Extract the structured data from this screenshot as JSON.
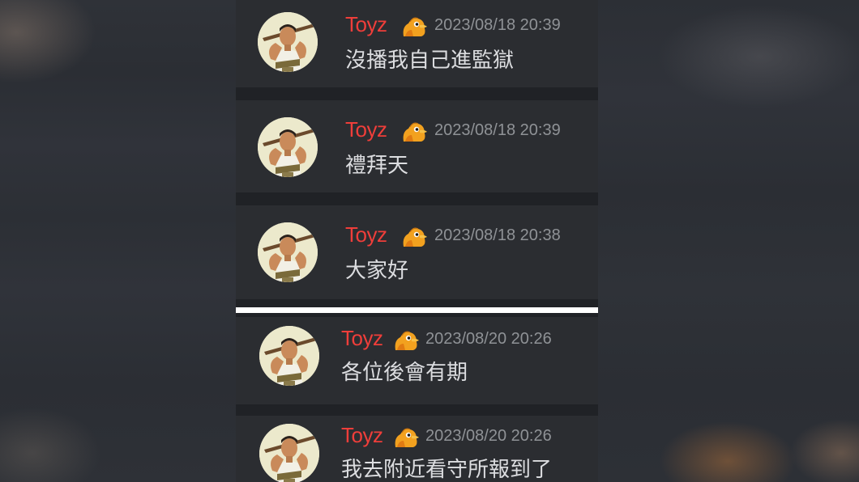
{
  "messages": [
    {
      "username": "Toyz",
      "timestamp": "2023/08/18 20:39",
      "text": "沒播我自己進監獄"
    },
    {
      "username": "Toyz",
      "timestamp": "2023/08/18 20:39",
      "text": "禮拜天"
    },
    {
      "username": "Toyz",
      "timestamp": "2023/08/18 20:38",
      "text": "大家好"
    },
    {
      "username": "Toyz",
      "timestamp": "2023/08/20 20:26",
      "text": "各位後會有期"
    },
    {
      "username": "Toyz",
      "timestamp": "2023/08/20 20:26",
      "text": "我去附近看守所報到了"
    }
  ],
  "colors": {
    "username": "#ef3e3a",
    "timestamp": "#8f9296",
    "message_text": "#dcdde0",
    "card_background": "#2b2d31",
    "divider": "#ffffff"
  },
  "icons": {
    "avatar": "user-avatar-photo",
    "badge": "bird-emoji-icon"
  }
}
